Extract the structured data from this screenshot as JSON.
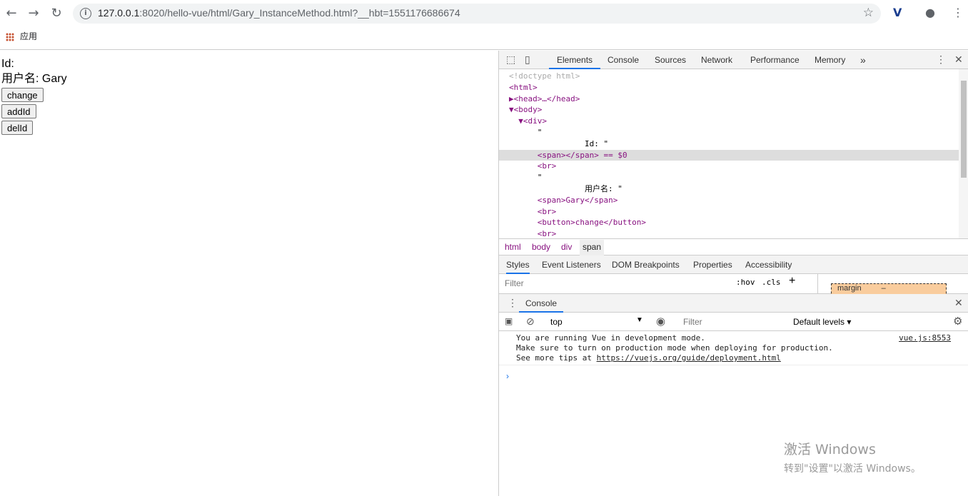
{
  "browser": {
    "url_host": "127.0.0.1",
    "url_rest": ":8020/hello-vue/html/Gary_InstanceMethod.html?__hbt=1551176686674",
    "bookmark_apps_label": "应用"
  },
  "page": {
    "id_line": "Id:",
    "username_line": "用户名: Gary",
    "buttons": [
      "change",
      "addId",
      "delId"
    ]
  },
  "devtools": {
    "tabs": [
      "Elements",
      "Console",
      "Sources",
      "Network",
      "Performance",
      "Memory"
    ],
    "more_tabs": "»",
    "dom_lines": [
      "<!doctype html>",
      "<html>",
      "▶<head>…</head>",
      "▼<body>",
      "  ▼<div>",
      "      \"",
      "                Id: \"",
      "      <span></span> == $0",
      "      <br>",
      "      \"",
      "                用户名: \"",
      "      <span>Gary</span>",
      "      <br>",
      "      <button>change</button>",
      "      <br>"
    ],
    "breadcrumbs": [
      "html",
      "body",
      "div",
      "span"
    ],
    "sub_tabs": [
      "Styles",
      "Event Listeners",
      "DOM Breakpoints",
      "Properties",
      "Accessibility"
    ],
    "filter_placeholder": "Filter",
    "hov_label": ":hov",
    "cls_label": ".cls",
    "margin_label": "margin",
    "margin_value": "–"
  },
  "console": {
    "tab_label": "Console",
    "context": "top",
    "filter_placeholder": "Filter",
    "levels": "Default levels ▾",
    "message_lines": [
      "You are running Vue in development mode.",
      "Make sure to turn on production mode when deploying for production.",
      "See more tips at "
    ],
    "message_link": "https://vuejs.org/guide/deployment.html",
    "message_source": "vue.js:8553"
  },
  "watermark": {
    "line1": "激活 Windows",
    "line2": "转到\"设置\"以激活 Windows。"
  }
}
